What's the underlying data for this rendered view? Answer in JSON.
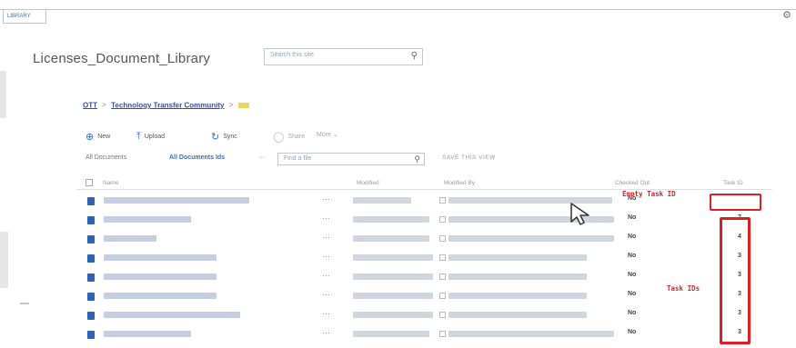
{
  "tab": {
    "label": "LIBRARY"
  },
  "library": {
    "title": "Licenses_Document_Library",
    "search_placeholder": "Search this site"
  },
  "breadcrumb": {
    "items": [
      "OTT",
      "Technology Transfer Community"
    ],
    "separator": ">"
  },
  "commands": {
    "new": "New",
    "upload": "Upload",
    "sync": "Sync",
    "share": "Share",
    "more": "More ⌄"
  },
  "views": {
    "view1": "All Documents",
    "view2": "All Documents Ids",
    "more": "···",
    "find_placeholder": "Find a file",
    "save_view": "SAVE THIS VIEW"
  },
  "columns": {
    "name": "Name",
    "modified": "Modified",
    "modified_by": "Modified By",
    "checked_out": "Checked Out",
    "task_id": "Task ID"
  },
  "rows": [
    {
      "checked": "No",
      "task_id": ""
    },
    {
      "checked": "No",
      "task_id": "7"
    },
    {
      "checked": "No",
      "task_id": "4"
    },
    {
      "checked": "No",
      "task_id": "3"
    },
    {
      "checked": "No",
      "task_id": "3"
    },
    {
      "checked": "No",
      "task_id": "3"
    },
    {
      "checked": "No",
      "task_id": "3"
    },
    {
      "checked": "No",
      "task_id": "3"
    }
  ],
  "annotations": {
    "empty": "Empty Task ID",
    "ids": "Task IDs"
  },
  "colors": {
    "annotation_red": "#e01e24",
    "link_blue": "#3a4f9a",
    "icon_blue": "#2e6fcb"
  }
}
